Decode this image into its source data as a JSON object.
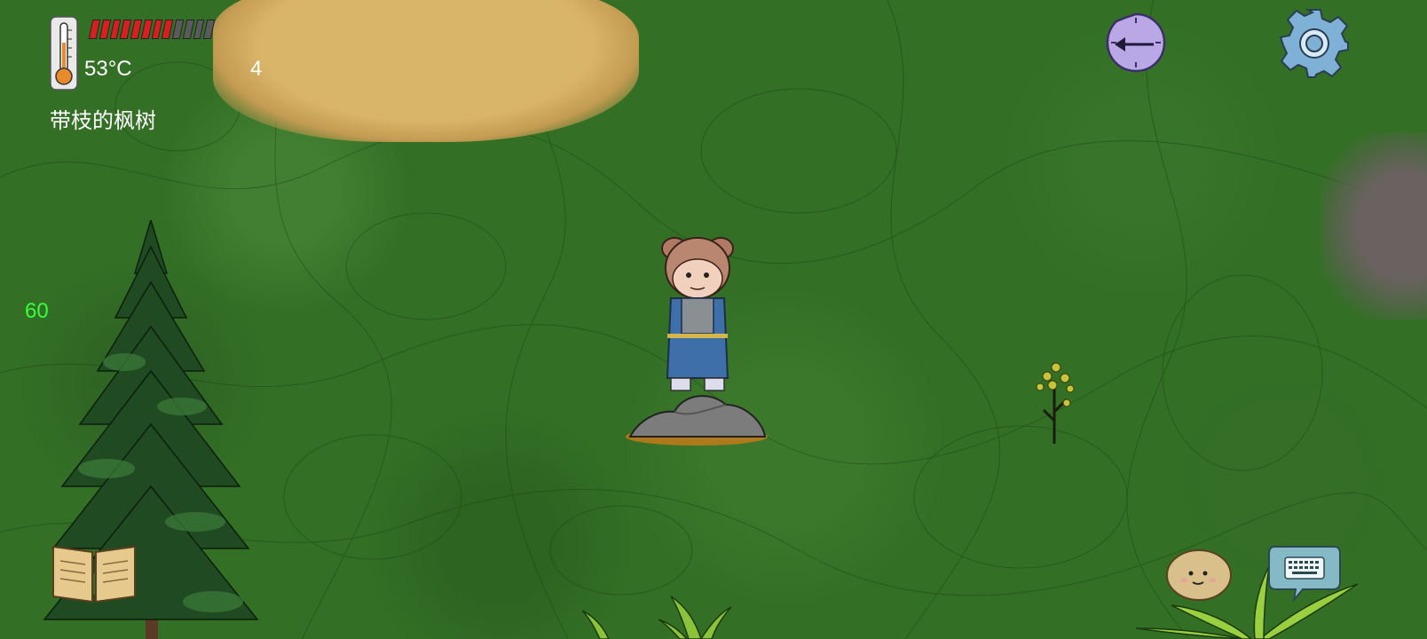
{
  "hud": {
    "temperature": "53°C",
    "held_count": "4",
    "held_item": "带枝的枫树",
    "fps": "60",
    "health_segments_total": 12,
    "health_segments_filled": 8,
    "health_color": "#d62020"
  },
  "buttons": {
    "clock_icon": "clock-arrow-icon",
    "settings_icon": "gear-icon",
    "book_icon": "book-icon",
    "emote_icon": "potato-face-icon",
    "keyboard_icon": "keyboard-icon"
  },
  "colors": {
    "ground": "#336f25",
    "sand": "#d9b56a",
    "fps": "#35ff3a"
  }
}
